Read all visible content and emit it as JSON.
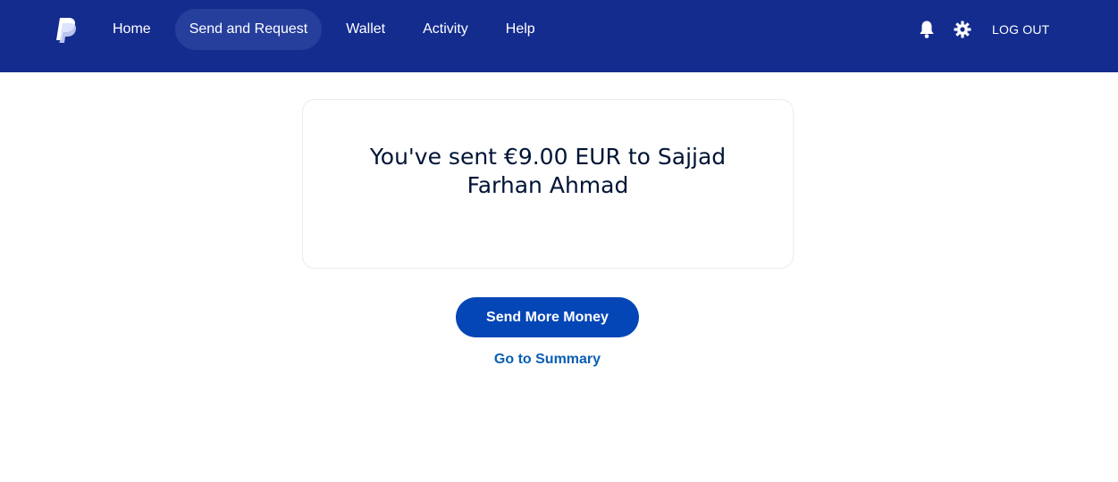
{
  "header": {
    "logo_icon": "paypal-logo-icon",
    "nav": [
      {
        "label": "Home",
        "active": false
      },
      {
        "label": "Send and Request",
        "active": true
      },
      {
        "label": "Wallet",
        "active": false
      },
      {
        "label": "Activity",
        "active": false
      },
      {
        "label": "Help",
        "active": false
      }
    ],
    "notifications_icon": "bell-icon",
    "settings_icon": "gear-icon",
    "logout_label": "LOG OUT"
  },
  "confirmation": {
    "message": "You've sent €9.00 EUR to Sajjad Farhan Ahmad"
  },
  "actions": {
    "send_more_label": "Send More Money",
    "summary_label": "Go to Summary"
  },
  "colors": {
    "header_bg": "#142c8e",
    "active_nav_bg": "#263f9c",
    "primary_button": "#0546b6",
    "link": "#0a5fb3",
    "text": "#001435"
  }
}
